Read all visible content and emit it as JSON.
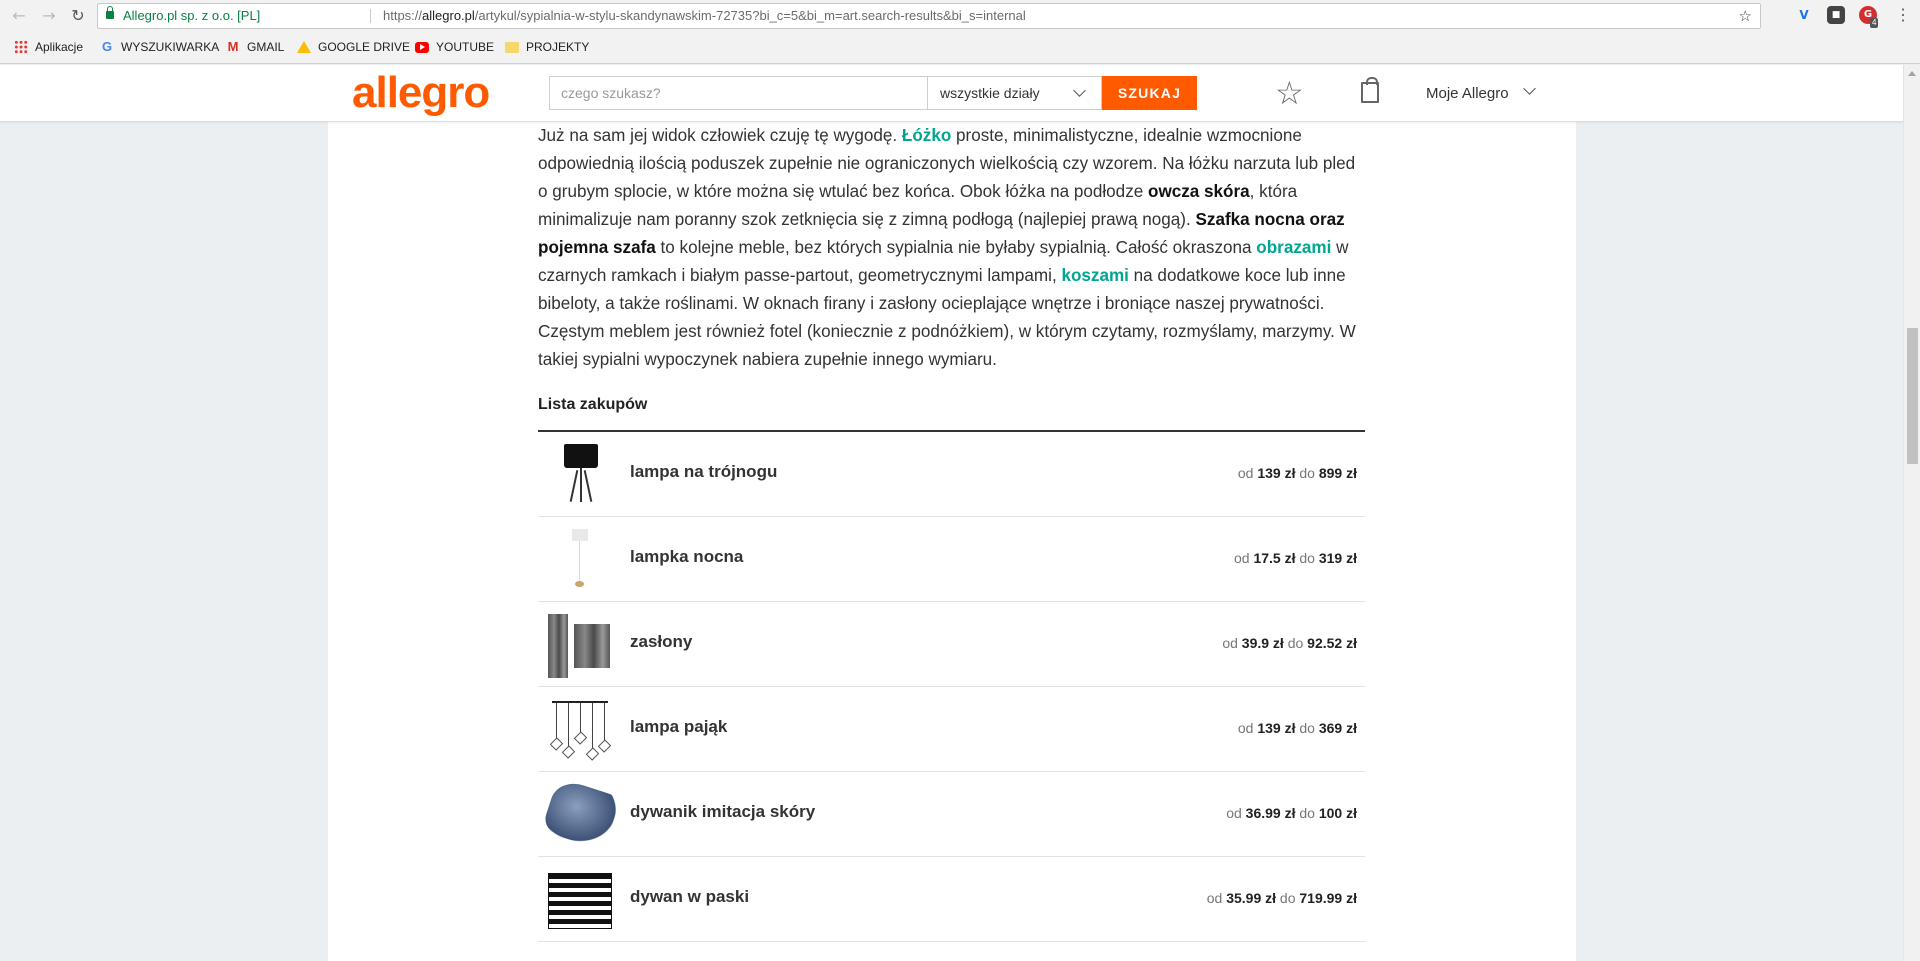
{
  "browser": {
    "site_identity": "Allegro.pl sp. z o.o. [PL]",
    "url_prefix": "https://",
    "url_host": "allegro.pl",
    "url_path": "/artykul/sypialnia-w-stylu-skandynawskim-72735?bi_c=5&bi_m=art.search-results&bi_s=internal",
    "extension_badge": "4",
    "bookmarks": [
      {
        "label": "Aplikacje",
        "icon": "apps-icon"
      },
      {
        "label": "WYSZUKIWARKA",
        "icon": "google-icon"
      },
      {
        "label": "GMAIL",
        "icon": "gmail-icon"
      },
      {
        "label": "GOOGLE DRIVE",
        "icon": "google-drive-icon"
      },
      {
        "label": "YOUTUBE",
        "icon": "youtube-icon"
      },
      {
        "label": "PROJEKTY",
        "icon": "folder-icon"
      }
    ]
  },
  "header": {
    "logo": "allegro",
    "search_placeholder": "czego szukasz?",
    "department": "wszystkie działy",
    "search_button": "SZUKAJ",
    "account": "Moje Allegro",
    "brand_color": "#ff5a00"
  },
  "article": {
    "p1": "Już na sam jej widok człowiek czuję tę wygodę. ",
    "link_lozko": "Łóżko",
    "p2": " proste, minimalistyczne, idealnie wzmocnione odpowiednią ilością poduszek zupełnie nie ograniczonych wielkością czy wzorem. Na łóżku narzuta lub pled o grubym splocie, w które można się wtulać bez końca. Obok łóżka na podłodze ",
    "b_owcza": "owcza skóra",
    "p3": ", która minimalizuje nam poranny szok zetknięcia się z zimną podłogą (najlepiej prawą nogą). ",
    "b_szafka": "Szafka nocna oraz pojemna szafa",
    "p4": " to kolejne meble, bez których sypialnia nie byłaby sypialnią. Całość okraszona ",
    "link_obrazami": "obrazami",
    "p5": " w czarnych ramkach i białym passe-partout, geometrycznymi lampami, ",
    "link_koszami": "koszami",
    "p6": " na dodatkowe koce lub inne bibeloty, a także roślinami. W oknach firany i zasłony ocieplające wnętrze i broniące naszej prywatności. Częstym meblem jest również fotel (koniecznie z podnóżkiem), w którym czytamy, rozmyślamy, marzymy. W takiej sypialni wypoczynek nabiera zupełnie innego wymiaru.",
    "link_color": "#00a790"
  },
  "shopping_list": {
    "title": "Lista zakupów",
    "from_label": "od",
    "to_label": "do",
    "items": [
      {
        "name": "lampa na trójnogu",
        "min": "139 zł",
        "max": "899 zł"
      },
      {
        "name": "lampka nocna",
        "min": "17.5 zł",
        "max": "319 zł"
      },
      {
        "name": "zasłony",
        "min": "39.9 zł",
        "max": "92.52 zł"
      },
      {
        "name": "lampa pająk",
        "min": "139 zł",
        "max": "369 zł"
      },
      {
        "name": "dywanik imitacja skóry",
        "min": "36.99 zł",
        "max": "100 zł"
      },
      {
        "name": "dywan w paski",
        "min": "35.99 zł",
        "max": "719.99 zł"
      }
    ]
  }
}
